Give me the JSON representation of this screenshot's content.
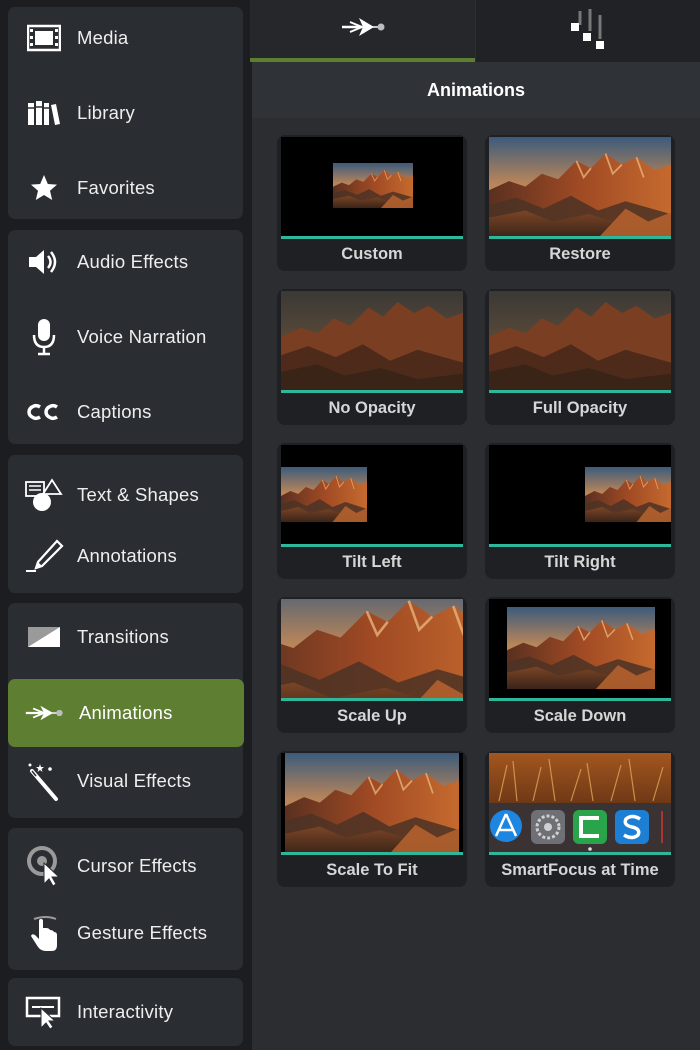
{
  "sidebar": {
    "items": [
      {
        "label": "Media",
        "icon": "film-icon"
      },
      {
        "label": "Library",
        "icon": "library-books-icon"
      },
      {
        "label": "Favorites",
        "icon": "star-icon"
      },
      {
        "label": "Audio Effects",
        "icon": "speaker-icon"
      },
      {
        "label": "Voice Narration",
        "icon": "microphone-icon"
      },
      {
        "label": "Captions",
        "icon": "cc-icon"
      },
      {
        "label": "Text & Shapes",
        "icon": "text-shapes-icon"
      },
      {
        "label": "Annotations",
        "icon": "pen-icon"
      },
      {
        "label": "Transitions",
        "icon": "transition-icon"
      },
      {
        "label": "Animations",
        "icon": "animation-arrow-icon"
      },
      {
        "label": "Visual Effects",
        "icon": "magic-wand-icon"
      },
      {
        "label": "Cursor Effects",
        "icon": "cursor-effect-icon"
      },
      {
        "label": "Gesture Effects",
        "icon": "gesture-hand-icon"
      },
      {
        "label": "Interactivity",
        "icon": "interactivity-icon"
      }
    ],
    "active": "Animations"
  },
  "tabs": [
    {
      "name": "animations-tab",
      "icon": "animation-arrow-icon",
      "selected": true
    },
    {
      "name": "behaviors-tab",
      "icon": "behaviors-icon",
      "selected": false
    }
  ],
  "panel": {
    "title": "Animations",
    "cards": [
      {
        "label": "Custom"
      },
      {
        "label": "Restore"
      },
      {
        "label": "No Opacity"
      },
      {
        "label": "Full Opacity"
      },
      {
        "label": "Tilt Left"
      },
      {
        "label": "Tilt Right"
      },
      {
        "label": "Scale Up"
      },
      {
        "label": "Scale Down"
      },
      {
        "label": "Scale To Fit"
      },
      {
        "label": "SmartFocus at Time"
      }
    ]
  },
  "colors": {
    "accent_green": "#5e7e31",
    "teal_bar": "#2fb79c",
    "panel_bg": "#2b2d31"
  }
}
